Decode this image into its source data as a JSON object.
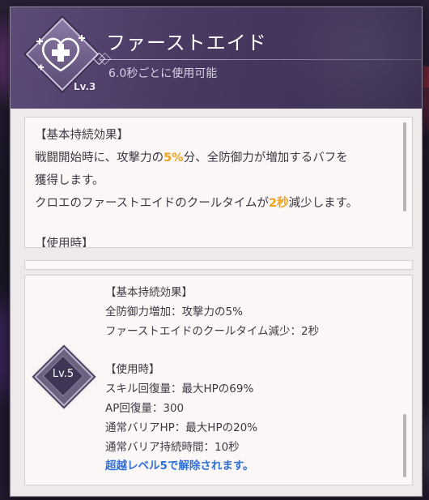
{
  "skill": {
    "title": "ファーストエイド",
    "subtitle": "6.0秒ごとに使用可能",
    "level_label": "Lv.3",
    "icon": "heart-plus-icon"
  },
  "description": {
    "line1": "【基本持続効果】",
    "line2_pre": "戦闘開始時に、攻撃力の",
    "line2_hl": "5%",
    "line2_post": "分、全防御力が増加するバフを",
    "line3": "獲得します。",
    "line4_pre": "クロエのファーストエイドのクールタイムが",
    "line4_hl": "2秒",
    "line4_post": "減少します。",
    "line5": "【使用時】"
  },
  "upgrade": {
    "level_label": "Lv.5",
    "lines": [
      "【基本持続効果】",
      "全防御力増加：攻撃力の5%",
      "ファーストエイドのクールタイム減少：2秒",
      "【使用時】",
      "スキル回復量：最大HPの69%",
      "AP回復量：300",
      "通常バリアHP：最大HPの20%",
      "通常バリア持続時間：10秒"
    ],
    "unlock_text": "超越レベル5で解除されます。"
  },
  "colors": {
    "highlight": "#f0a21c",
    "unlock": "#2f6fd6",
    "header": "#4a3a63"
  }
}
